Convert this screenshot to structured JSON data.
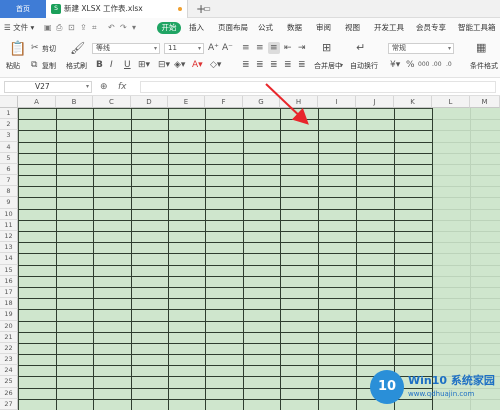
{
  "tabs": {
    "home": "首页",
    "document": "新建 XLSX 工作表.xlsx"
  },
  "menubar": {
    "file": "文件",
    "items": [
      "开始",
      "插入",
      "页面布局",
      "公式",
      "数据",
      "审阅",
      "视图",
      "开发工具",
      "会员专享",
      "智能工具箱"
    ],
    "active": "开始"
  },
  "ribbon": {
    "paste": "粘贴",
    "cut": "剪切",
    "copy": "复制",
    "format_painter": "格式刷",
    "font_name": "等线",
    "font_size": "11",
    "merge_center": "合并居中",
    "wrap_text": "自动换行",
    "number_format": "常规",
    "conditional_format": "条件格式"
  },
  "formula_bar": {
    "cell_ref": "V27",
    "fx": "fx",
    "value": ""
  },
  "sheet": {
    "columns": [
      "A",
      "B",
      "C",
      "D",
      "E",
      "F",
      "G",
      "H",
      "I",
      "J",
      "K",
      "L",
      "M"
    ],
    "rows": [
      "1",
      "2",
      "3",
      "4",
      "5",
      "6",
      "7",
      "8",
      "9",
      "10",
      "11",
      "12",
      "13",
      "14",
      "15",
      "16",
      "17",
      "18",
      "19",
      "20",
      "21",
      "22",
      "23",
      "24",
      "25",
      "26",
      "27"
    ],
    "cell_fill": "#cfe6cd",
    "border_color": "#2f3e2f"
  },
  "watermark": {
    "logo": "10",
    "title": "Win10 系统家园",
    "url": "www.qdhuajin.com"
  }
}
